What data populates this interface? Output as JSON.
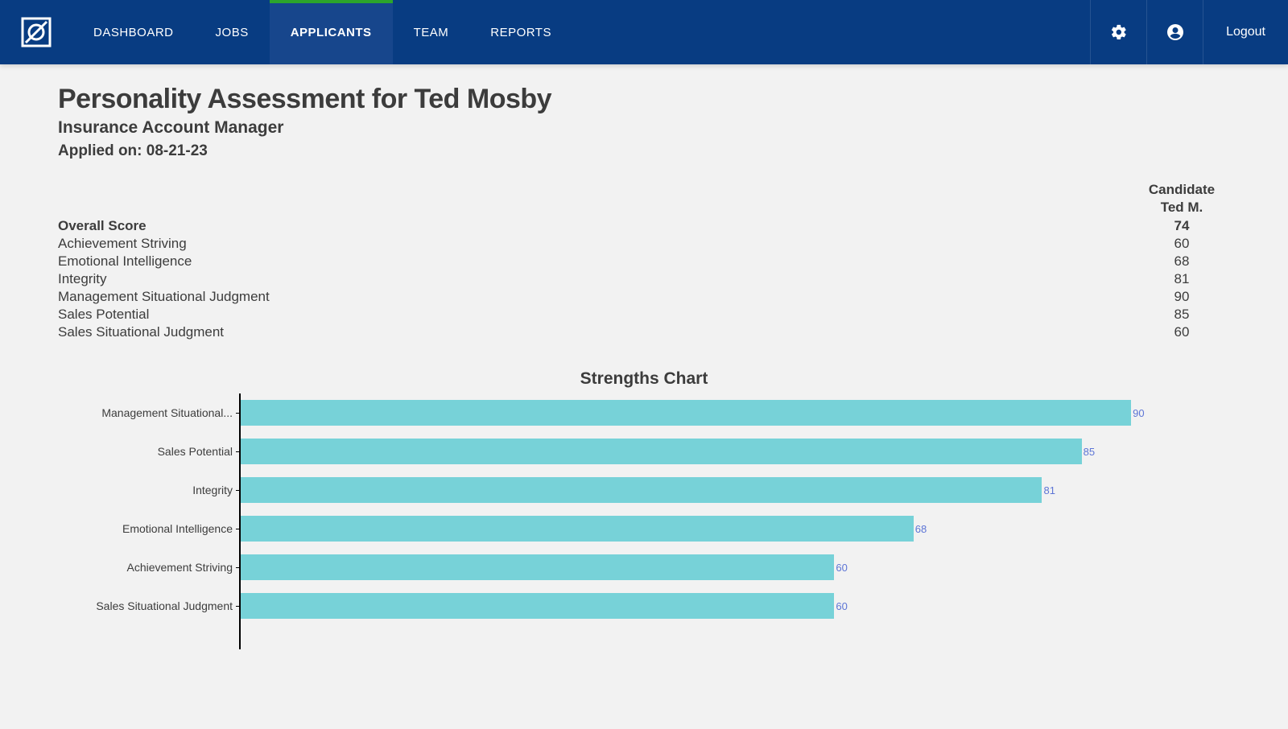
{
  "nav": {
    "links": [
      "DASHBOARD",
      "JOBS",
      "APPLICANTS",
      "TEAM",
      "REPORTS"
    ],
    "active_index": 2,
    "logout": "Logout"
  },
  "header": {
    "title": "Personality Assessment for Ted Mosby",
    "subtitle": "Insurance Account Manager",
    "applied_label": "Applied on: ",
    "applied_date": "08-21-23"
  },
  "scores": {
    "column_header_top": "Candidate",
    "column_header_bottom": "Ted M.",
    "overall_label": "Overall Score",
    "overall_value": 74,
    "rows": [
      {
        "label": "Achievement Striving",
        "value": 60
      },
      {
        "label": "Emotional Intelligence",
        "value": 68
      },
      {
        "label": "Integrity",
        "value": 81
      },
      {
        "label": "Management Situational Judgment",
        "value": 90
      },
      {
        "label": "Sales Potential",
        "value": 85
      },
      {
        "label": "Sales Situational Judgment",
        "value": 60
      }
    ]
  },
  "chart_data": {
    "type": "bar",
    "orientation": "horizontal",
    "title": "Strengths Chart",
    "xlim": [
      0,
      100
    ],
    "bar_color": "#77d2d8",
    "value_label_color": "#5d75d6",
    "categories": [
      "Management Situational...",
      "Sales Potential",
      "Integrity",
      "Emotional Intelligence",
      "Achievement Striving",
      "Sales Situational Judgment"
    ],
    "values": [
      90,
      85,
      81,
      68,
      60,
      60
    ]
  }
}
